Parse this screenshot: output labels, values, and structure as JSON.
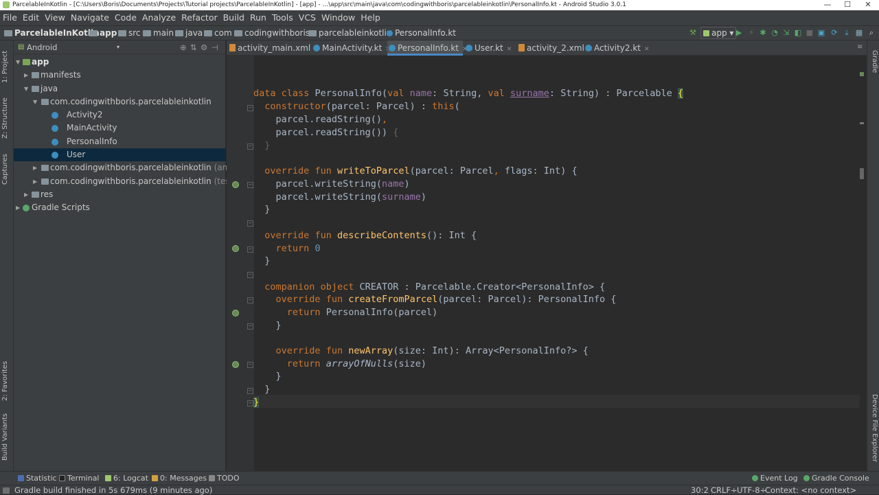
{
  "titlebar": {
    "title": "ParcelableInKotlin - [C:\\Users\\Boris\\Documents\\Projects\\Tutorial projects\\ParcelableInKotlin] - [app] - ...\\app\\src\\main\\java\\com\\codingwithboris\\parcelableinkotlin\\PersonalInfo.kt - Android Studio 3.0.1",
    "minimize": "—",
    "maximize": "☐",
    "close": "✕"
  },
  "menu": [
    "File",
    "Edit",
    "View",
    "Navigate",
    "Code",
    "Analyze",
    "Refactor",
    "Build",
    "Run",
    "Tools",
    "VCS",
    "Window",
    "Help"
  ],
  "breadcrumb": [
    "ParcelableInKotlin",
    "app",
    "src",
    "main",
    "java",
    "com",
    "codingwithboris",
    "parcelableinkotlin",
    "PersonalInfo.kt"
  ],
  "run_config": "app",
  "project_panel": {
    "view_mode": "Android",
    "left_tabs": [
      "1: Project",
      "Z: Structure",
      "Captures",
      "2: Favorites",
      "Build Variants"
    ],
    "tree": [
      {
        "label": "app",
        "bold": true
      },
      {
        "label": "manifests"
      },
      {
        "label": "java"
      },
      {
        "label": "com.codingwithboris.parcelableinkotlin"
      },
      {
        "label": "Activity2"
      },
      {
        "label": "MainActivity"
      },
      {
        "label": "PersonalInfo"
      },
      {
        "label": "User"
      },
      {
        "label": "com.codingwithboris.parcelableinkotlin",
        "suffix": "(androidTest)"
      },
      {
        "label": "com.codingwithboris.parcelableinkotlin",
        "suffix": "(test)"
      },
      {
        "label": "res"
      },
      {
        "label": "Gradle Scripts"
      }
    ]
  },
  "editor_tabs": [
    "activity_main.xml",
    "MainActivity.kt",
    "PersonalInfo.kt",
    "User.kt",
    "activity_2.xml",
    "Activity2.kt"
  ],
  "right_tabs": [
    "Gradle",
    "Device File Explorer"
  ],
  "status_tools": [
    "Statistic",
    "Terminal",
    "6: Logcat",
    "0: Messages",
    "TODO"
  ],
  "status_right_tools": [
    "Event Log",
    "Gradle Console"
  ],
  "status_message": "Gradle build finished in 5s 679ms (9 minutes ago)",
  "cursor_pos": "30:2",
  "line_sep": "CRLF÷",
  "encoding": "UTF-8÷",
  "context": "Context: <no context>",
  "code": {
    "kw_data": "data",
    "kw_class": "class",
    "cls": "PersonalInfo",
    "kw_val": "val",
    "p_name": "name",
    "p_surname": "surname",
    "t_string": "String",
    "parcelable": "Parcelable",
    "kw_constructor": "constructor",
    "parcel": "parcel",
    "t_parcel": "Parcel",
    "kw_this": "this",
    "readString": "readString",
    "kw_override": "override",
    "kw_fun": "fun",
    "writeToParcel": "writeToParcel",
    "flags": "flags",
    "t_int": "Int",
    "writeString": "writeString",
    "describeContents": "describeContents",
    "kw_return": "return",
    "zero": "0",
    "kw_companion": "companion",
    "kw_object": "object",
    "creator": "CREATOR",
    "creator_type": "Parcelable.Creator<PersonalInfo>",
    "createFromParcel": "createFromParcel",
    "newArray": "newArray",
    "size": "size",
    "array_type": "Array<PersonalInfo?>",
    "arrayOfNulls": "arrayOfNulls"
  }
}
